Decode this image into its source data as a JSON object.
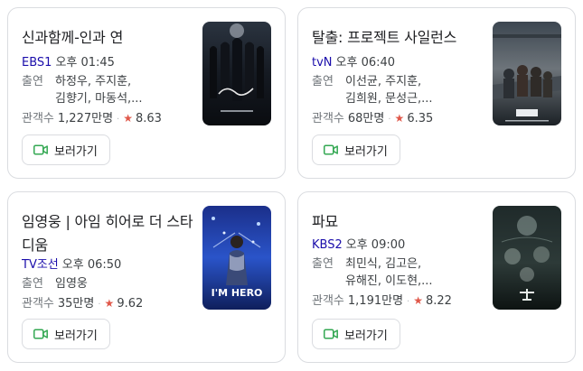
{
  "cards": [
    {
      "title": "신과함께-인과 연",
      "channel": "EBS1",
      "time": "오후 01:45",
      "cast_label": "출연",
      "cast_line1": "하정우, 주지훈,",
      "cast_line2": "김향기, 마동석,...",
      "viewers_label": "관객수",
      "viewers": "1,227만명",
      "rating": "8.63",
      "button_label": "보러가기"
    },
    {
      "title": "탈출: 프로젝트 사일런스",
      "channel": "tvN",
      "time": "오후 06:40",
      "cast_label": "출연",
      "cast_line1": "이선균, 주지훈,",
      "cast_line2": "김희원, 문성근,...",
      "viewers_label": "관객수",
      "viewers": "68만명",
      "rating": "6.35",
      "button_label": "보러가기"
    },
    {
      "title": "임영웅 | 아임 히어로 더 스타디움",
      "channel": "TV조선",
      "time": "오후 06:50",
      "cast_label": "출연",
      "cast_line1": "임영웅",
      "cast_line2": "",
      "viewers_label": "관객수",
      "viewers": "35만명",
      "rating": "9.62",
      "button_label": "보러가기"
    },
    {
      "title": "파묘",
      "channel": "KBS2",
      "time": "오후 09:00",
      "cast_label": "출연",
      "cast_line1": "최민식, 김고은,",
      "cast_line2": "유해진, 이도현,...",
      "viewers_label": "관객수",
      "viewers": "1,191만명",
      "rating": "8.22",
      "button_label": "보러가기"
    }
  ],
  "colors": {
    "channel_link": "#1a0dab",
    "star": "#e0584a",
    "video_icon": "#34a853"
  },
  "icons": [
    "video-camera-icon",
    "star-icon"
  ]
}
